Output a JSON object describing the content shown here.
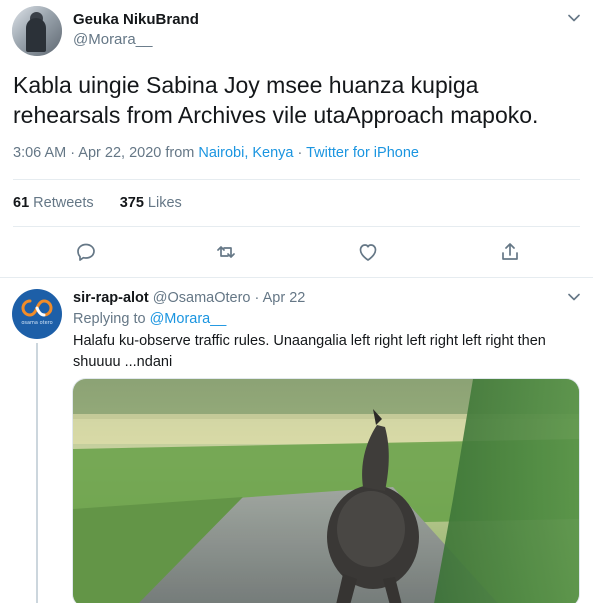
{
  "main_tweet": {
    "author_name": "Geuka NikuBrand",
    "author_handle": "@Morara__",
    "text": "Kabla uingie Sabina Joy msee huanza kupiga rehearsals from Archives vile utaApproach mapoko.",
    "time_date": "3:06 AM · Apr 22, 2020 from ",
    "location": "Nairobi, Kenya",
    "separator": " · ",
    "source": "Twitter for iPhone",
    "retweets_count": "61",
    "retweets_label": "Retweets",
    "likes_count": "375",
    "likes_label": "Likes"
  },
  "actions": {
    "icons": [
      "reply-icon",
      "retweet-icon",
      "like-icon",
      "share-icon"
    ]
  },
  "reply_tweet": {
    "author_name": "sir-rap-alot",
    "author_handle": "@OsamaOtero",
    "date": " · Apr 22",
    "replying_prefix": "Replying to ",
    "replying_to": "@Morara__",
    "text": "Halafu ku-observe traffic rules. Unaangalia left right left right left right then shuuuu ...ndani",
    "avatar_caption": "osama otero"
  },
  "colors": {
    "link": "#1b95e0",
    "muted": "#657786",
    "text": "#14171a",
    "divider": "#e6ecf0"
  }
}
